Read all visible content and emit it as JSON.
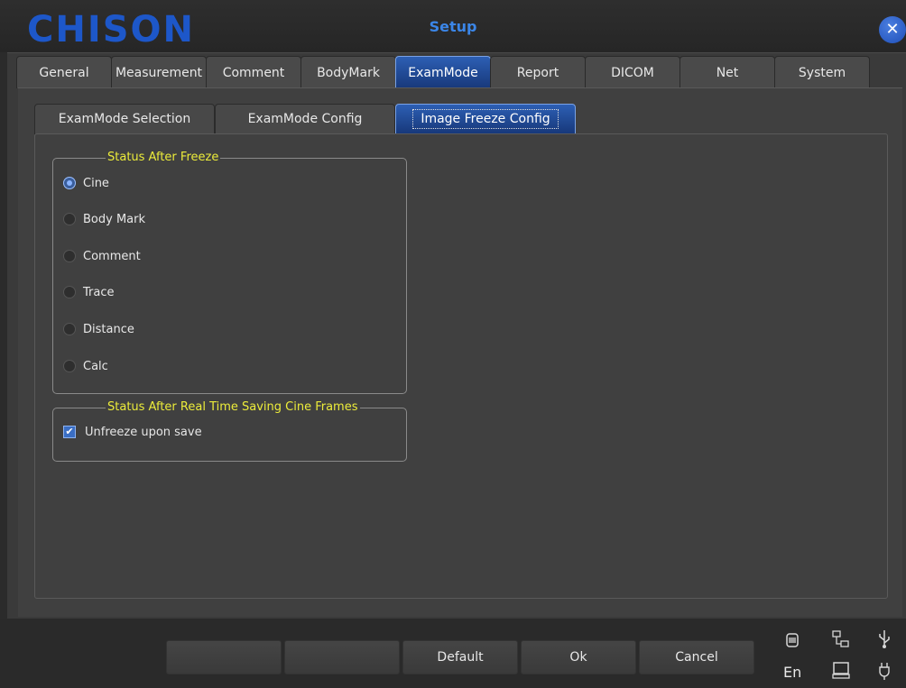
{
  "window": {
    "logo": "CHISON",
    "title": "Setup"
  },
  "tabs": [
    "General",
    "Measurement",
    "Comment",
    "BodyMark",
    "ExamMode",
    "Report",
    "DICOM",
    "Net",
    "System"
  ],
  "active_tab": "ExamMode",
  "subtabs": [
    "ExamMode Selection",
    "ExamMode Config",
    "Image Freeze Config"
  ],
  "active_subtab": "Image Freeze Config",
  "freeze_group": {
    "title": "Status After Freeze",
    "options": [
      "Cine",
      "Body Mark",
      "Comment",
      "Trace",
      "Distance",
      "Calc"
    ],
    "selected": "Cine"
  },
  "cine_group": {
    "title": "Status After Real Time Saving Cine Frames",
    "checkbox_label": "Unfreeze upon save",
    "checked": true
  },
  "buttons": {
    "blank1": "",
    "blank2": "",
    "default": "Default",
    "ok": "Ok",
    "cancel": "Cancel"
  },
  "status": {
    "language": "En"
  },
  "icons": [
    "disk-icon",
    "network-icon",
    "usb-icon",
    "display-icon",
    "power-plug-icon"
  ]
}
